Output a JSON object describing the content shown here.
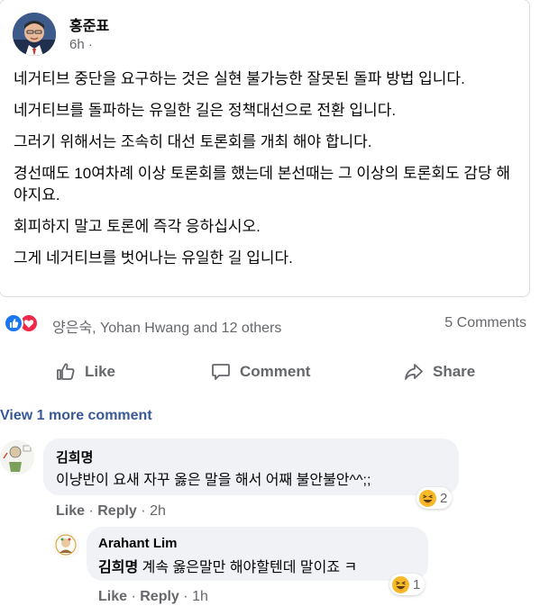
{
  "post": {
    "author": "홍준표",
    "time": "6h",
    "separator": "·",
    "paragraphs": [
      "네거티브  중단을 요구하는 것은 실현 불가능한 잘못된 돌파 방법 입니다.",
      "네거티브를 돌파하는 유일한 길은 정책대선으로 전환 입니다.",
      "그러기 위해서는 조속히 대선 토론회를 개최 해야 합니다.",
      "경선때도 10여차례 이상 토론회를 했는데 본선때는 그 이상의 토론회도 감당 해야지요.",
      "회피하지 말고 토론에 즉각 응하십시오.",
      "그게 네거티브를 벗어나는 유일한 길 입니다."
    ]
  },
  "reactions": {
    "names": "양은숙, Yohan Hwang and 12 others",
    "comments_count": "5 Comments",
    "icons": [
      "like-icon",
      "love-icon"
    ]
  },
  "actions": {
    "like": "Like",
    "comment": "Comment",
    "share": "Share"
  },
  "view_more": "View 1 more comment",
  "comments": [
    {
      "author": "김희명",
      "text": "이냥반이 요새 자꾸 옳은 말을 해서 어째 불안불안^^;;",
      "reaction_icon": "haha-icon",
      "reaction_count": "2",
      "like": "Like",
      "reply": "Reply",
      "separator": "·",
      "time": "2h"
    },
    {
      "author": "Arahant Lim",
      "mention": "김희명",
      "text": "계속 옳은말만 해야할텐데 말이죠 ㅋ",
      "reaction_icon": "haha-icon",
      "reaction_count": "1",
      "like": "Like",
      "reply": "Reply",
      "separator": "·",
      "time": "1h"
    }
  ],
  "colors": {
    "like_blue": "#1877f2",
    "love_red": "#f0284a",
    "haha_yellow": "#f7b928",
    "link_blue": "#385898",
    "secondary_text": "#65676b",
    "bubble_bg": "#f0f2f5"
  }
}
